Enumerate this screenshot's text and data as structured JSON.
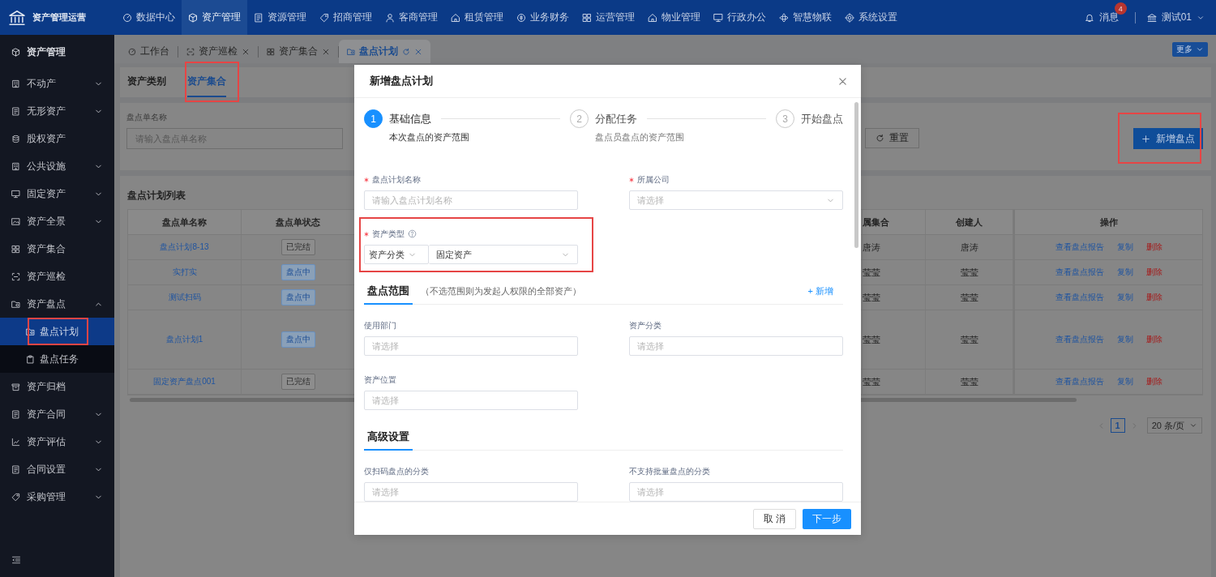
{
  "header": {
    "logo": "资产管理运营",
    "nav": [
      {
        "label": "数据中心",
        "selected": false
      },
      {
        "label": "资产管理",
        "selected": true
      },
      {
        "label": "资源管理",
        "selected": false
      },
      {
        "label": "招商管理",
        "selected": false
      },
      {
        "label": "客商管理",
        "selected": false
      },
      {
        "label": "租赁管理",
        "selected": false
      },
      {
        "label": "业务财务",
        "selected": false
      },
      {
        "label": "运营管理",
        "selected": false
      },
      {
        "label": "物业管理",
        "selected": false
      },
      {
        "label": "行政办公",
        "selected": false
      },
      {
        "label": "智慧物联",
        "selected": false
      },
      {
        "label": "系统设置",
        "selected": false
      }
    ],
    "messages": {
      "label": "消息",
      "count": "4"
    },
    "user": "测试01"
  },
  "sidebar": {
    "title": "资产管理",
    "items": [
      {
        "label": "不动产",
        "kind": "group",
        "expanded": false
      },
      {
        "label": "无形资产",
        "kind": "group",
        "expanded": false
      },
      {
        "label": "股权资产",
        "kind": "link"
      },
      {
        "label": "公共设施",
        "kind": "group",
        "expanded": false
      },
      {
        "label": "固定资产",
        "kind": "group",
        "expanded": false
      },
      {
        "label": "资产全景",
        "kind": "group",
        "expanded": false
      },
      {
        "label": "资产集合",
        "kind": "link"
      },
      {
        "label": "资产巡检",
        "kind": "link"
      },
      {
        "label": "资产盘点",
        "kind": "group",
        "expanded": true,
        "children": [
          {
            "label": "盘点计划",
            "selected": true,
            "highlighted": true
          },
          {
            "label": "盘点任务",
            "selected": false,
            "highlighted": false
          }
        ]
      },
      {
        "label": "资产归档",
        "kind": "link"
      },
      {
        "label": "资产合同",
        "kind": "group",
        "expanded": false
      },
      {
        "label": "资产评估",
        "kind": "group",
        "expanded": false
      },
      {
        "label": "合同设置",
        "kind": "group",
        "expanded": false
      },
      {
        "label": "采购管理",
        "kind": "group",
        "expanded": false
      }
    ]
  },
  "page_tabs": [
    {
      "label": "工作台",
      "selected": false,
      "closable": false
    },
    {
      "label": "资产巡检",
      "selected": false,
      "closable": true
    },
    {
      "label": "资产集合",
      "selected": false,
      "closable": true
    },
    {
      "label": "盘点计划",
      "selected": true,
      "closable": true
    }
  ],
  "more_button": "更多",
  "sub_tabs": [
    {
      "label": "资产类别",
      "selected": false,
      "highlighted": false
    },
    {
      "label": "资产集合",
      "selected": true,
      "highlighted": true
    }
  ],
  "search": {
    "label": "盘点单名称",
    "placeholder": "请输入盘点单名称",
    "reset_button": "重置",
    "new_button": {
      "label": "新增盘点",
      "highlighted": true
    }
  },
  "table": {
    "title": "盘点计划列表",
    "columns": [
      "盘点单名称",
      "盘点单状态",
      "属集合",
      "创建人",
      "操作"
    ],
    "rows": [
      {
        "name": "盘点计划8-13",
        "status": {
          "label": "已完结",
          "kind": "done"
        },
        "column_3": "唐涛",
        "creator": "唐涛",
        "actions": [
          {
            "label": "查看盘点报告",
            "kind": "link"
          },
          {
            "label": "复制",
            "kind": "link"
          },
          {
            "label": "删除",
            "kind": "danger"
          }
        ]
      },
      {
        "name": "实打实",
        "status": {
          "label": "盘点中",
          "kind": "active"
        },
        "column_3": "莹莹",
        "creator": "莹莹",
        "actions": [
          {
            "label": "查看盘点报告",
            "kind": "link"
          },
          {
            "label": "复制",
            "kind": "link"
          },
          {
            "label": "删除",
            "kind": "danger"
          }
        ]
      },
      {
        "name": "测试扫码",
        "status": {
          "label": "盘点中",
          "kind": "active"
        },
        "column_3": "莹莹",
        "creator": "莹莹",
        "actions": [
          {
            "label": "查看盘点报告",
            "kind": "link"
          },
          {
            "label": "复制",
            "kind": "link"
          },
          {
            "label": "删除",
            "kind": "danger"
          }
        ]
      },
      {
        "name": "盘点计划1",
        "status": {
          "label": "盘点中",
          "kind": "active"
        },
        "column_3": "莹莹",
        "creator": "莹莹",
        "actions": [
          {
            "label": "查看盘点报告",
            "kind": "link"
          },
          {
            "label": "复制",
            "kind": "link"
          },
          {
            "label": "删除",
            "kind": "danger"
          }
        ]
      },
      {
        "name": "固定资产盘点001",
        "status": {
          "label": "已完结",
          "kind": "done"
        },
        "column_3": "莹莹",
        "creator": "莹莹",
        "actions": [
          {
            "label": "查看盘点报告",
            "kind": "link"
          },
          {
            "label": "复制",
            "kind": "link"
          },
          {
            "label": "删除",
            "kind": "danger"
          }
        ]
      }
    ],
    "pagination": {
      "pages": [
        {
          "label": "1",
          "selected": true
        }
      ],
      "page_size": "20 条/页"
    }
  },
  "modal": {
    "title": "新增盘点计划",
    "steps": [
      {
        "number": "1",
        "title": "基础信息",
        "subtitle": "本次盘点的资产范围",
        "selected": true
      },
      {
        "number": "2",
        "title": "分配任务",
        "subtitle": "盘点员盘点的资产范围",
        "selected": false
      },
      {
        "number": "3",
        "title": "开始盘点",
        "selected": false
      }
    ],
    "fields": [
      {
        "label": "盘点计划名称",
        "required": true,
        "kind": "input",
        "placeholder": "请输入盘点计划名称"
      },
      {
        "label": "所属公司",
        "required": true,
        "kind": "select",
        "placeholder": "请选择"
      }
    ],
    "asset_type": {
      "label": "资产类型",
      "required": true,
      "help": true,
      "highlighted": true,
      "values": [
        "资产分类",
        "固定资产"
      ]
    },
    "sections": [
      {
        "title": "盘点范围",
        "note": "（不选范围则为发起人权限的全部资产）",
        "add_link": "+ 新增",
        "fields": [
          {
            "label": "使用部门",
            "required": false,
            "kind": "input",
            "placeholder": "请选择"
          },
          {
            "label": "资产分类",
            "required": false,
            "kind": "input",
            "placeholder": "请选择"
          },
          {
            "label": "资产位置",
            "required": false,
            "kind": "input",
            "placeholder": "请选择"
          }
        ]
      },
      {
        "title": "高级设置",
        "fields": [
          {
            "label": "仅扫码盘点的分类",
            "required": false,
            "kind": "input",
            "placeholder": "请选择"
          },
          {
            "label": "不支持批量盘点的分类",
            "required": false,
            "kind": "input",
            "placeholder": "请选择"
          }
        ]
      }
    ],
    "cancel_button": "取 消",
    "next_button": "下一步"
  }
}
